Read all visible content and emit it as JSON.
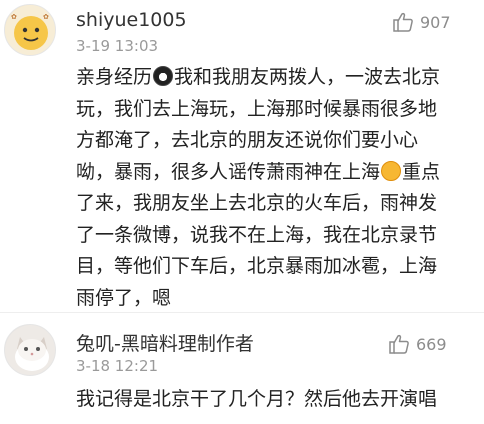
{
  "comments": [
    {
      "username": "shiyue1005",
      "timestamp": "3-19 13:03",
      "likes": "907",
      "lines": [
        [
          "亲身经历",
          "我和我朋友两拨人，一波去北京"
        ],
        [
          "玩，我们去上海玩，上海那时候暴雨很多地"
        ],
        [
          "方都淹了，去北京的朋友还说你们要小心"
        ],
        [
          "呦，暴雨，很多人谣传萧雨神在上海",
          "重点"
        ],
        [
          "了来，我朋友坐上去北京的火车后，雨神发"
        ],
        [
          "了一条微博，说我不在上海，我在北京录节"
        ],
        [
          "目，等他们下车后，北京暴雨加冰雹，上海"
        ],
        [
          "雨停了，嗯"
        ]
      ]
    },
    {
      "username": "兔叽-黑暗料理制作者",
      "timestamp": "3-18 12:21",
      "likes": "669",
      "lines": [
        [
          "我记得是北京干了几个月？然后他去开演唱"
        ]
      ]
    }
  ],
  "icons": {
    "like": "thumbs-up-icon",
    "avatar_1": "cartoon-face-avatar",
    "avatar_2": "cat-photo-avatar",
    "emoji_1": "face-emoji-icon",
    "emoji_2": "grin-emoji-icon"
  },
  "colors": {
    "username": "#333333",
    "timestamp": "#9a9a9a",
    "like": "#8c8c8c",
    "text": "#222222"
  }
}
